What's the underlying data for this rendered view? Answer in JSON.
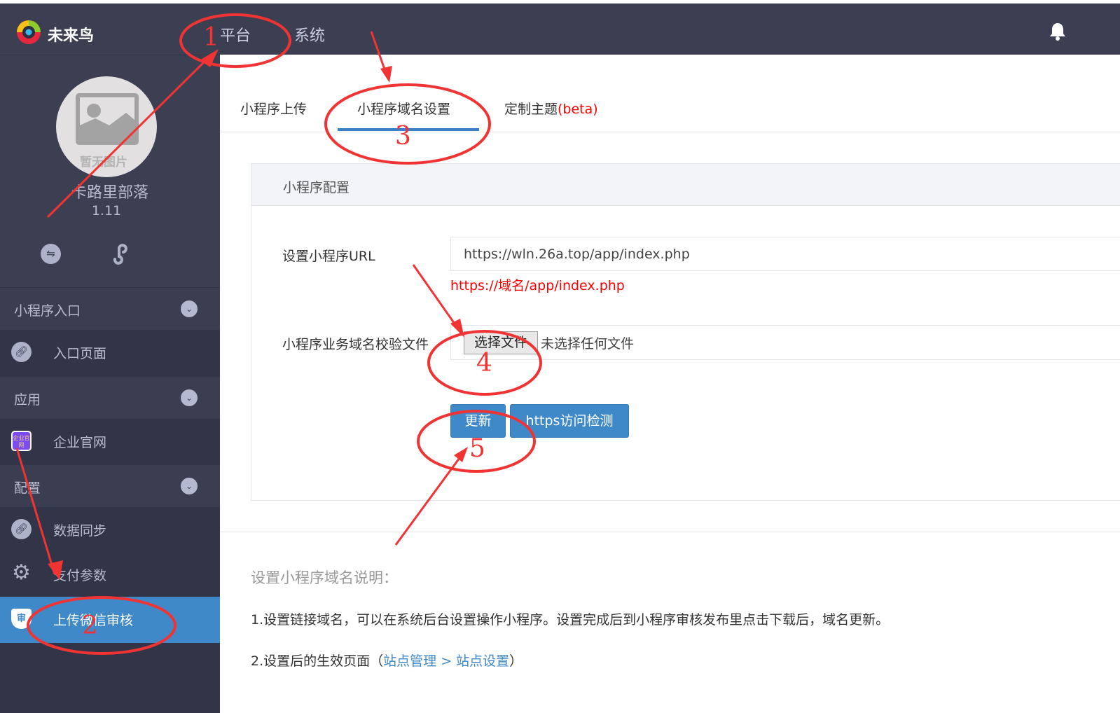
{
  "header": {
    "logo_text": "未来鸟",
    "nav": [
      "平台",
      "系统"
    ],
    "bell_icon": "bell-icon"
  },
  "profile": {
    "no_image": "暂无图片",
    "name": "卡路里部落",
    "version": "1.11"
  },
  "sidebar": {
    "groups": [
      {
        "label": "小程序入口",
        "items": [
          {
            "label": "入口页面",
            "icon": "link-icon"
          }
        ]
      },
      {
        "label": "应用",
        "items": [
          {
            "label": "企业官网",
            "icon": "enterprise-icon",
            "icon_text": "企业官网"
          }
        ]
      },
      {
        "label": "配置",
        "items": [
          {
            "label": "数据同步",
            "icon": "link-icon"
          },
          {
            "label": "支付参数",
            "icon": "gear-icon"
          },
          {
            "label": "上传微信审核",
            "icon": "shield-icon",
            "icon_text": "审",
            "active": true
          }
        ]
      }
    ]
  },
  "tabs": [
    {
      "label": "小程序上传"
    },
    {
      "label": "小程序域名设置",
      "active": true
    },
    {
      "label": "定制主题",
      "suffix": "(beta)"
    }
  ],
  "panel": {
    "title": "小程序配置",
    "url_label": "设置小程序URL",
    "url_value": "https://wln.26a.top/app/index.php",
    "url_hint": "https://域名/app/index.php",
    "file_label": "小程序业务域名校验文件",
    "file_button": "选择文件",
    "file_status": "未选择任何文件",
    "update_button": "更新",
    "check_button": "https访问检测"
  },
  "description": {
    "title": "设置小程序域名说明：",
    "line1": "1.设置链接域名，可以在系统后台设置操作小程序。设置完成后到小程序审核发布里点击下载后，域名更新。",
    "line2_prefix": "2.设置后的生效页面（",
    "link1": "站点管理",
    "sep": " > ",
    "link2": "站点设置",
    "line2_suffix": "）"
  },
  "annotations": [
    "1",
    "2",
    "3",
    "4",
    "5"
  ],
  "colors": {
    "accent": "#3f89c9",
    "annotation": "#f03434",
    "hint": "#ff0000"
  }
}
